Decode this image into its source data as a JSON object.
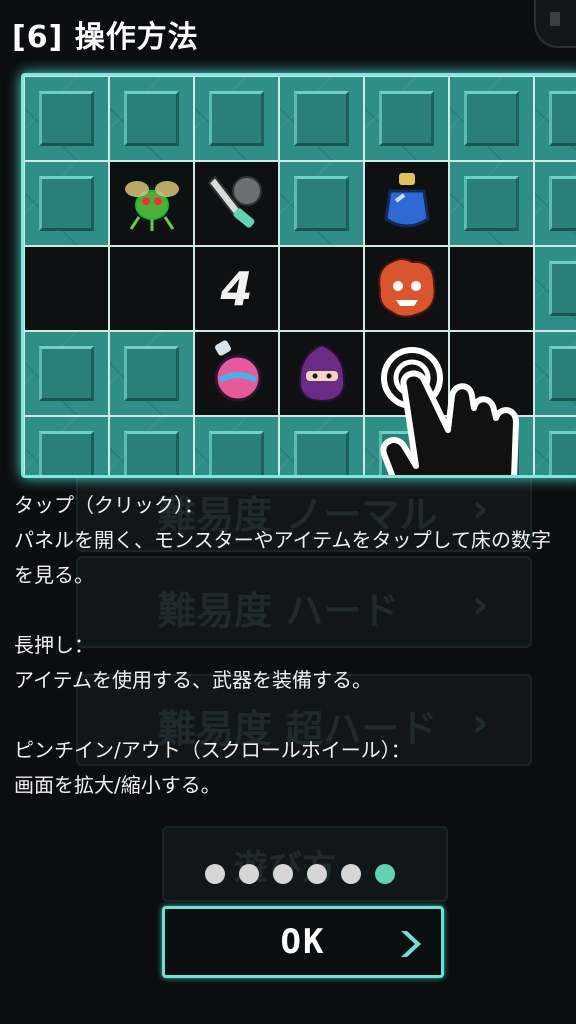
{
  "title": "[6] 操作方法",
  "background_menu": [
    "難易度 ノーマル",
    "難易度 ハード",
    "難易度 超ハード",
    "遊び方"
  ],
  "board": {
    "rows": [
      [
        "closed",
        "closed",
        "closed",
        "closed",
        "closed",
        "closed",
        "closed"
      ],
      [
        "closed",
        "monster-bug",
        "weapon-sword",
        "closed",
        "item-blue-potion",
        "closed",
        "closed"
      ],
      [
        "open",
        "open",
        "number",
        "open",
        "monster-flame",
        "open",
        "closed"
      ],
      [
        "closed",
        "closed",
        "item-pink-potion",
        "monster-ninja",
        "open",
        "open",
        "closed"
      ],
      [
        "closed",
        "closed",
        "closed",
        "closed",
        "closed",
        "closed",
        "closed"
      ]
    ],
    "number_value": "4"
  },
  "help": {
    "tap_heading": "タップ（クリック）：",
    "tap_body": "パネルを開く、モンスターやアイテムをタップして床の数字を見る。",
    "hold_heading": "長押し：",
    "hold_body": "アイテムを使用する、武器を装備する。",
    "pinch_heading": "ピンチイン/アウト（スクロールホイール）：",
    "pinch_body": "画面を拡大/縮小する。"
  },
  "pagination": {
    "total": 6,
    "current": 6
  },
  "ok_label": "OK",
  "colors": {
    "accent": "#6ee0d6",
    "panel": "#2f8e86",
    "active_dot": "#5fd3b4"
  },
  "icons": [
    "speaker-icon",
    "hand-tap-icon",
    "chevron-right-icon"
  ]
}
